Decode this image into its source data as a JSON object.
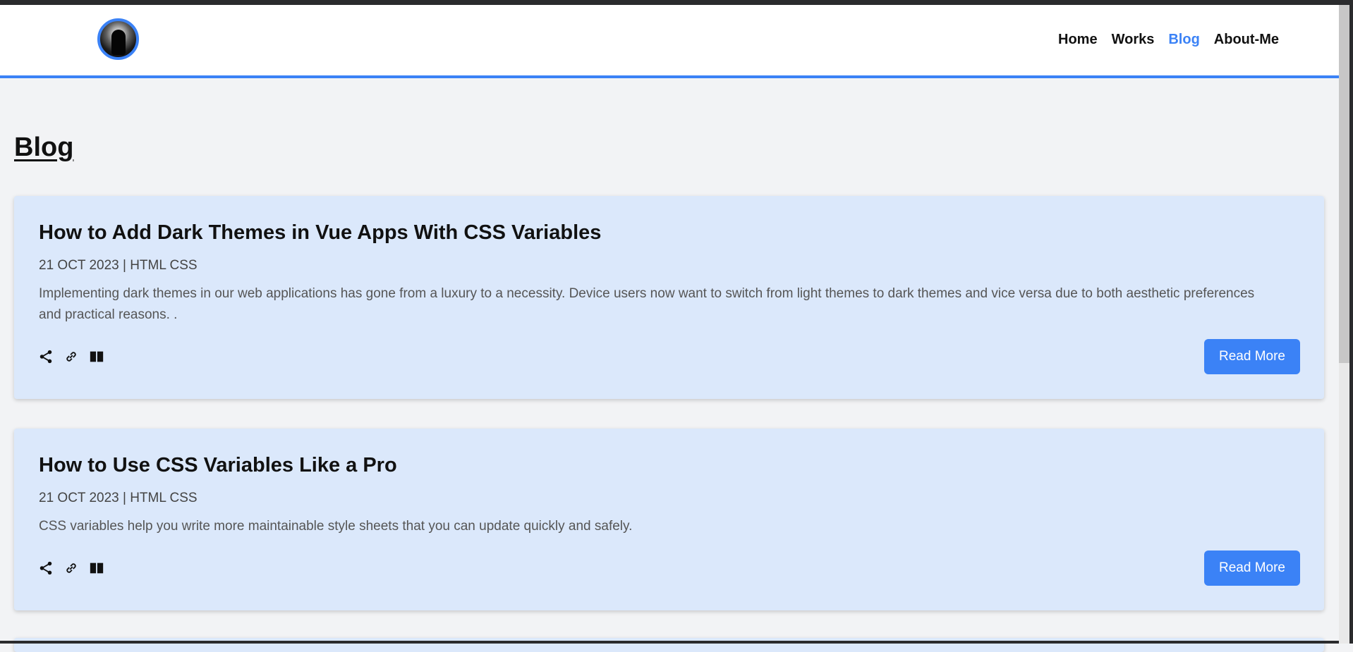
{
  "nav": {
    "items": [
      {
        "label": "Home",
        "active": false
      },
      {
        "label": "Works",
        "active": false
      },
      {
        "label": "Blog",
        "active": true
      },
      {
        "label": "About-Me",
        "active": false
      }
    ]
  },
  "page": {
    "title": "Blog"
  },
  "posts": [
    {
      "title": "How to Add Dark Themes in Vue Apps With CSS Variables",
      "meta": "21 OCT 2023 | HTML CSS",
      "excerpt": "Implementing dark themes in our web applications has gone from a luxury to a necessity. Device users now want to switch from light themes to dark themes and vice versa due to both aesthetic preferences and practical reasons. .",
      "read_more": "Read More"
    },
    {
      "title": "How to Use CSS Variables Like a Pro",
      "meta": "21 OCT 2023 | HTML CSS",
      "excerpt": "CSS variables help you write more maintainable style sheets that you can update quickly and safely.",
      "read_more": "Read More"
    }
  ],
  "icons": [
    "share-icon",
    "link-icon",
    "book-icon",
    "avatar"
  ],
  "colors": {
    "accent": "#3b82f6",
    "card_bg": "#dbe8fb",
    "page_bg": "#f2f3f5"
  }
}
